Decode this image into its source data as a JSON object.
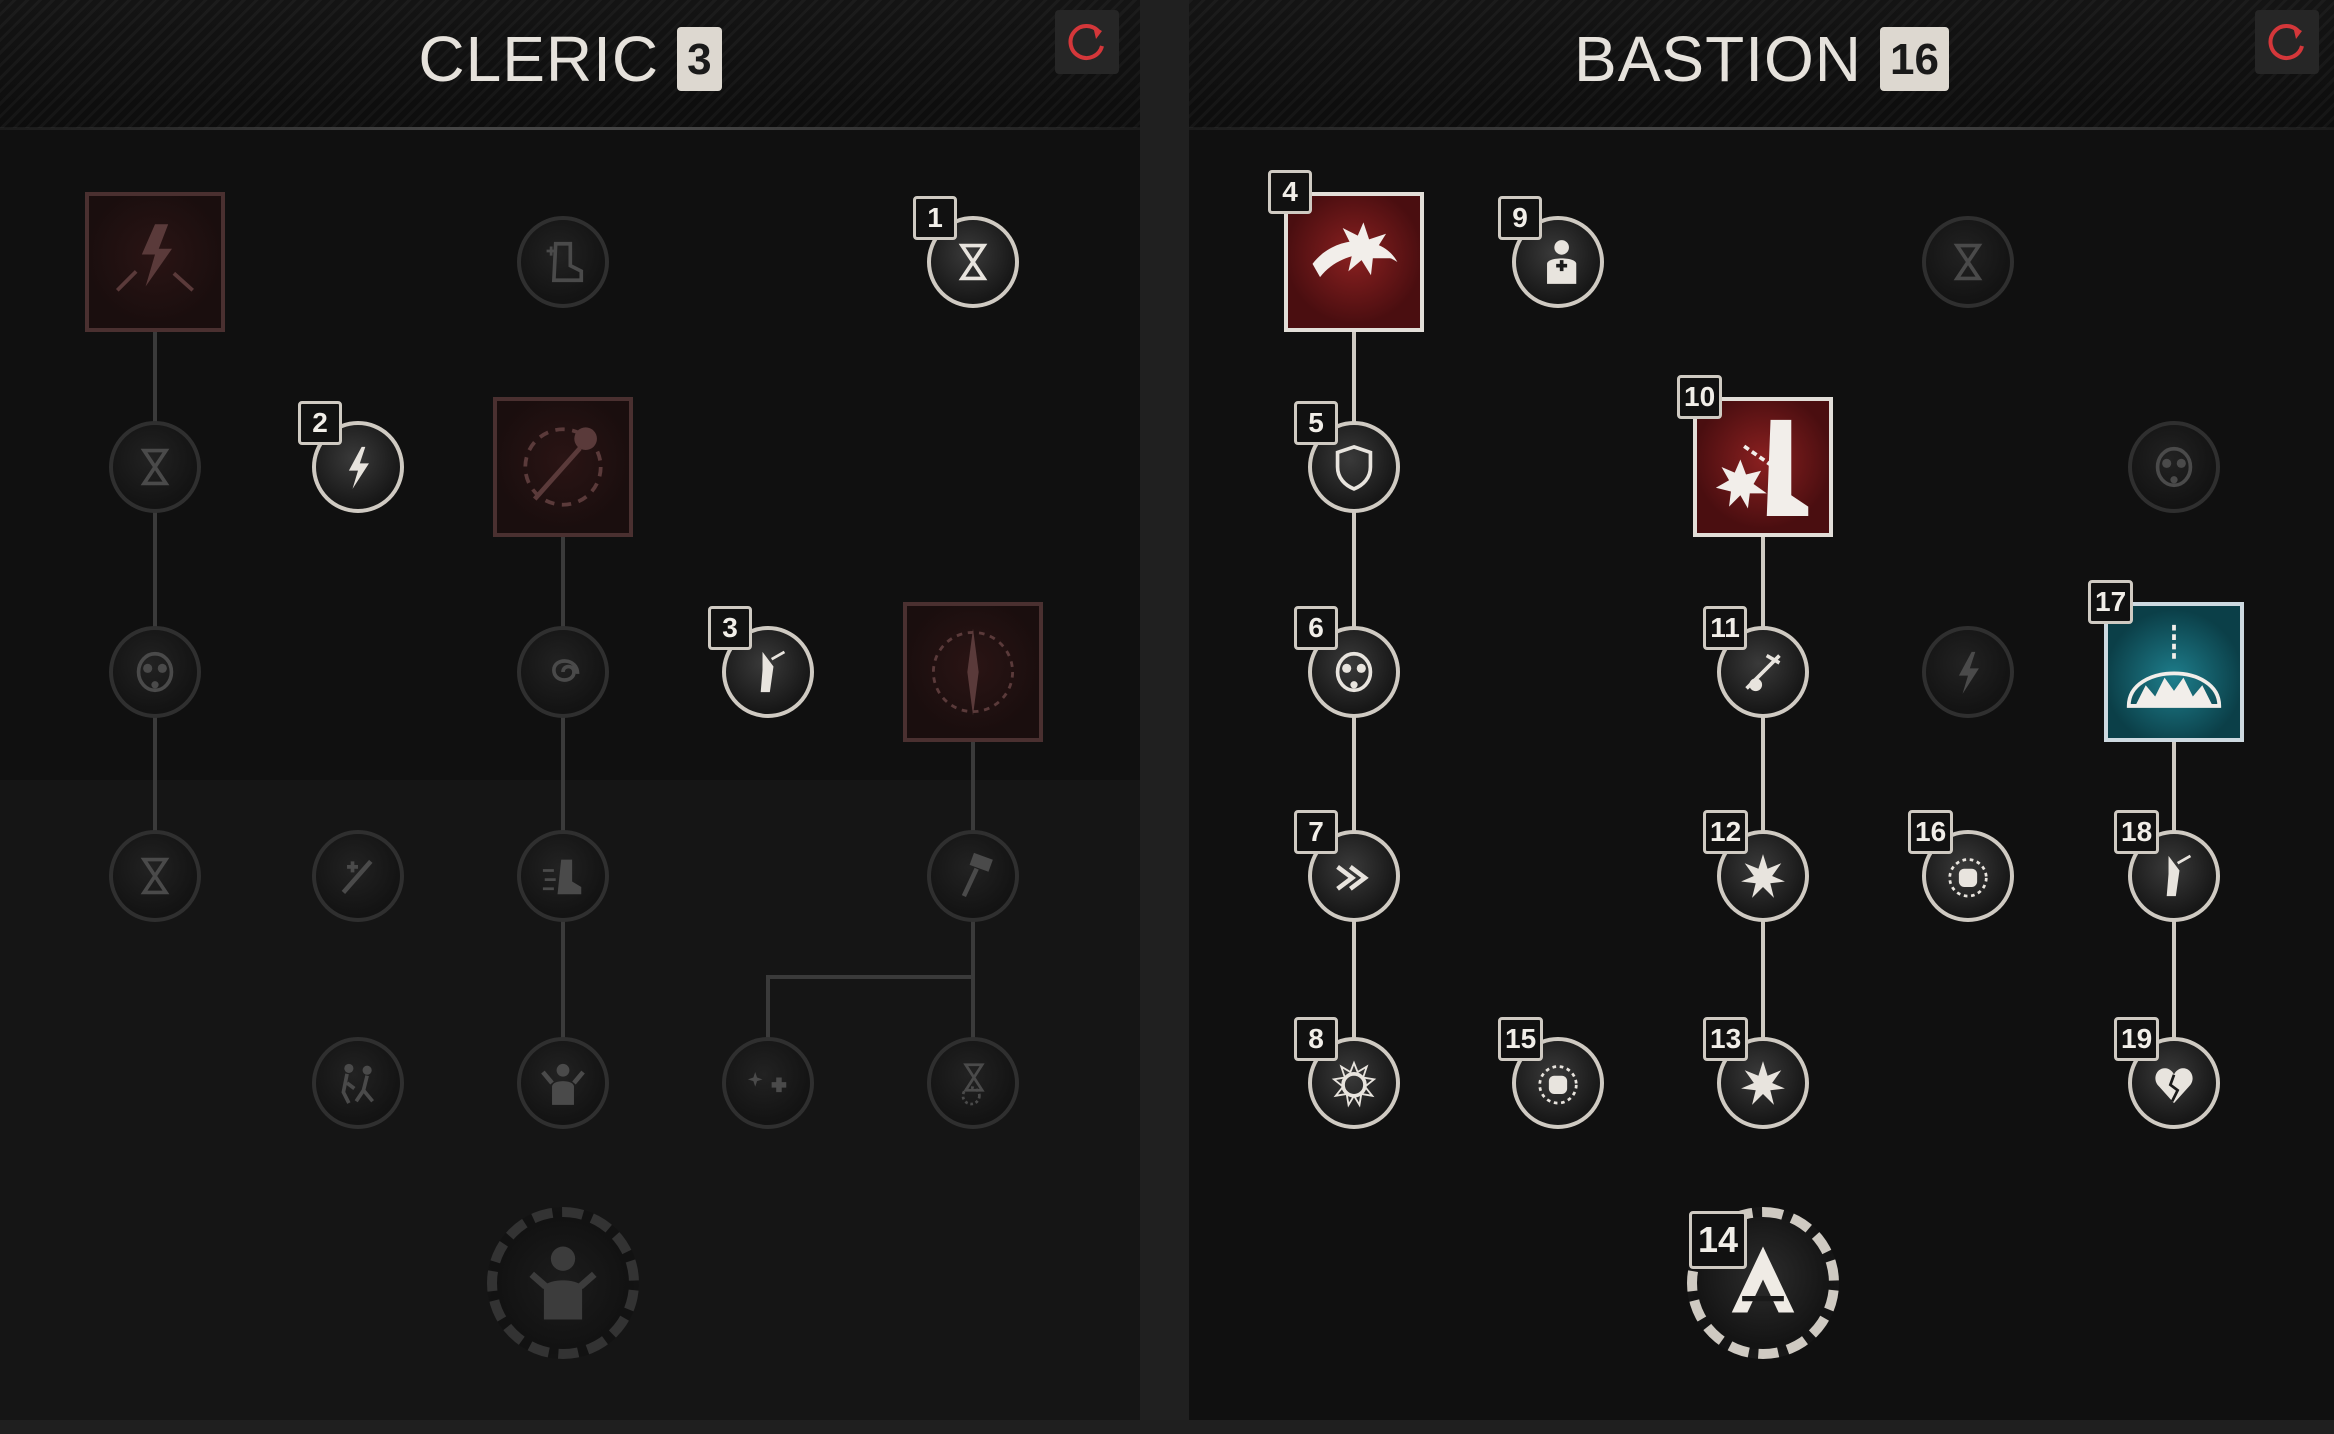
{
  "cleric": {
    "name": "CLERIC",
    "points": "3",
    "reset_icon": "reset-icon",
    "nodes": [
      {
        "id": "c-r1-1",
        "shape": "square",
        "icon": "lightning-burst-icon",
        "active": false
      },
      {
        "id": "c-r1-3",
        "shape": "circle",
        "icon": "medical-boot-icon",
        "active": false
      },
      {
        "id": "c-r1-5",
        "shape": "circle",
        "icon": "hourglass-icon",
        "active": true,
        "badge": "1"
      },
      {
        "id": "c-r2-1",
        "shape": "circle",
        "icon": "hourglass-icon",
        "active": false
      },
      {
        "id": "c-r2-2",
        "shape": "circle",
        "icon": "lightning-icon",
        "active": true,
        "badge": "2"
      },
      {
        "id": "c-r2-3",
        "shape": "square",
        "icon": "ringed-mace-icon",
        "active": false
      },
      {
        "id": "c-r3-1",
        "shape": "circle",
        "icon": "gas-mask-icon",
        "active": false
      },
      {
        "id": "c-r3-3",
        "shape": "circle",
        "icon": "swirl-icon",
        "active": false
      },
      {
        "id": "c-r3-4",
        "shape": "circle",
        "icon": "holding-arm-icon",
        "active": true,
        "badge": "3"
      },
      {
        "id": "c-r3-5",
        "shape": "square",
        "icon": "spike-ring-icon",
        "active": false
      },
      {
        "id": "c-r4-1",
        "shape": "circle",
        "icon": "hourglass-icon",
        "active": false
      },
      {
        "id": "c-r4-2",
        "shape": "circle",
        "icon": "medical-strike-icon",
        "active": false
      },
      {
        "id": "c-r4-3",
        "shape": "circle",
        "icon": "speed-boot-icon",
        "active": false
      },
      {
        "id": "c-r4-5",
        "shape": "circle",
        "icon": "hammer-icon",
        "active": false
      },
      {
        "id": "c-r5-2",
        "shape": "circle",
        "icon": "running-figures-icon",
        "active": false
      },
      {
        "id": "c-r5-3",
        "shape": "circle",
        "icon": "flexing-figure-icon",
        "active": false
      },
      {
        "id": "c-r5-4",
        "shape": "circle",
        "icon": "sparkle-medical-icon",
        "active": false
      },
      {
        "id": "c-r5-5",
        "shape": "circle",
        "icon": "hourglass-burst-icon",
        "active": false
      },
      {
        "id": "c-capstone",
        "shape": "big",
        "icon": "fighter-stance-icon",
        "active": false
      }
    ]
  },
  "bastion": {
    "name": "BASTION",
    "points": "16",
    "reset_icon": "reset-icon",
    "nodes": [
      {
        "id": "b-r1-1",
        "shape": "square",
        "icon": "sweeping-strike-icon",
        "active": true,
        "badge": "4"
      },
      {
        "id": "b-r1-2",
        "shape": "circle",
        "icon": "medic-torso-icon",
        "active": true,
        "badge": "9"
      },
      {
        "id": "b-r1-4",
        "shape": "circle",
        "icon": "hourglass-icon",
        "active": false
      },
      {
        "id": "b-r2-1",
        "shape": "circle",
        "icon": "shield-icon",
        "active": true,
        "badge": "5"
      },
      {
        "id": "b-r2-3",
        "shape": "square",
        "icon": "chained-leg-icon",
        "active": true,
        "badge": "10"
      },
      {
        "id": "b-r2-5",
        "shape": "circle",
        "icon": "gas-mask-icon",
        "active": false
      },
      {
        "id": "b-r3-1",
        "shape": "circle",
        "icon": "gas-mask-icon",
        "active": true,
        "badge": "6"
      },
      {
        "id": "b-r3-3",
        "shape": "circle",
        "icon": "crossed-mace-icon",
        "active": true,
        "badge": "11"
      },
      {
        "id": "b-r3-4",
        "shape": "circle",
        "icon": "lightning-icon",
        "active": false
      },
      {
        "id": "b-r3-5",
        "shape": "square",
        "icon": "dome-burst-icon",
        "active": true,
        "badge": "17",
        "color": "blue"
      },
      {
        "id": "b-r4-1",
        "shape": "circle",
        "icon": "double-arrow-icon",
        "active": true,
        "badge": "7"
      },
      {
        "id": "b-r4-3",
        "shape": "circle",
        "icon": "spiked-burst-icon",
        "active": true,
        "badge": "12"
      },
      {
        "id": "b-r4-4",
        "shape": "circle",
        "icon": "fist-burst-icon",
        "active": true,
        "badge": "16"
      },
      {
        "id": "b-r4-5",
        "shape": "circle",
        "icon": "holding-arm-icon",
        "active": true,
        "badge": "18"
      },
      {
        "id": "b-r5-1",
        "shape": "circle",
        "icon": "gear-burst-icon",
        "active": true,
        "badge": "8"
      },
      {
        "id": "b-r5-2",
        "shape": "circle",
        "icon": "fist-burst-icon",
        "active": true,
        "badge": "15"
      },
      {
        "id": "b-r5-3",
        "shape": "circle",
        "icon": "spiked-burst-icon",
        "active": true,
        "badge": "13"
      },
      {
        "id": "b-r5-5",
        "shape": "circle",
        "icon": "broken-heart-icon",
        "active": true,
        "badge": "19"
      },
      {
        "id": "b-capstone",
        "shape": "big",
        "icon": "bastion-emblem-icon",
        "active": true,
        "badge": "14"
      }
    ]
  },
  "colors": {
    "active_border": "#cfcac2",
    "inactive_border": "#2f2f2f",
    "active_square": "#7a1a1c",
    "blue_square": "#1e7e8c",
    "reset_red": "#d4373a"
  }
}
